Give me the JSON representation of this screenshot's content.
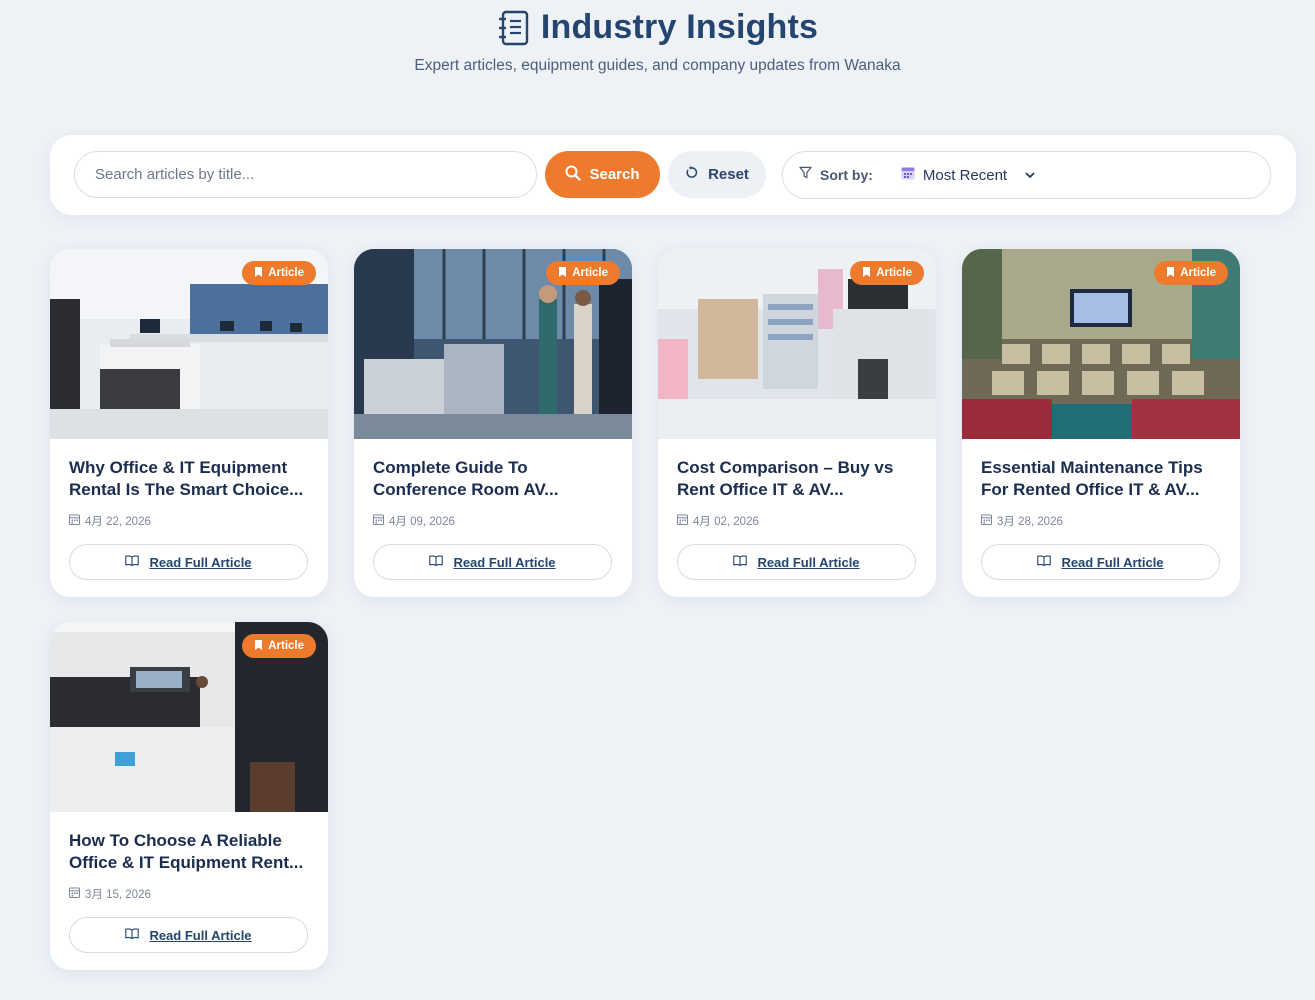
{
  "header": {
    "title": "Industry Insights",
    "subtitle": "Expert articles, equipment guides, and company updates from Wanaka",
    "icon": "journal-list-icon",
    "color": "#23456f"
  },
  "search": {
    "placeholder": "Search articles by title...",
    "value": "",
    "search_label": "Search",
    "reset_label": "Reset"
  },
  "sort": {
    "label": "Sort by:",
    "selected": "Most Recent"
  },
  "colors": {
    "accent": "#ee7a2d",
    "title": "#1b2d4f",
    "background": "#eef2f7"
  },
  "articles": [
    {
      "badge": "Article",
      "title": "Why Office & IT Equipment Rental Is The Smart Choice...",
      "date": "4月 22, 2026",
      "cta": "Read Full Article",
      "image": "office-floor-printer-photo"
    },
    {
      "badge": "Article",
      "title": "Complete Guide To Conference Room AV...",
      "date": "4月 09, 2026",
      "cta": "Read Full Article",
      "image": "office-copiers-people-photo"
    },
    {
      "badge": "Article",
      "title": "Cost Comparison – Buy vs Rent Office IT & AV...",
      "date": "4月 02, 2026",
      "cta": "Read Full Article",
      "image": "printer-closeup-photo"
    },
    {
      "badge": "Article",
      "title": "Essential Maintenance Tips For Rented Office IT & AV...",
      "date": "3月 28, 2026",
      "cta": "Read Full Article",
      "image": "conference-room-chairs-photo"
    },
    {
      "badge": "Article",
      "title": "How To Choose A Reliable Office & IT Equipment Rent...",
      "date": "3月 15, 2026",
      "cta": "Read Full Article",
      "image": "man-using-copier-photo"
    }
  ]
}
